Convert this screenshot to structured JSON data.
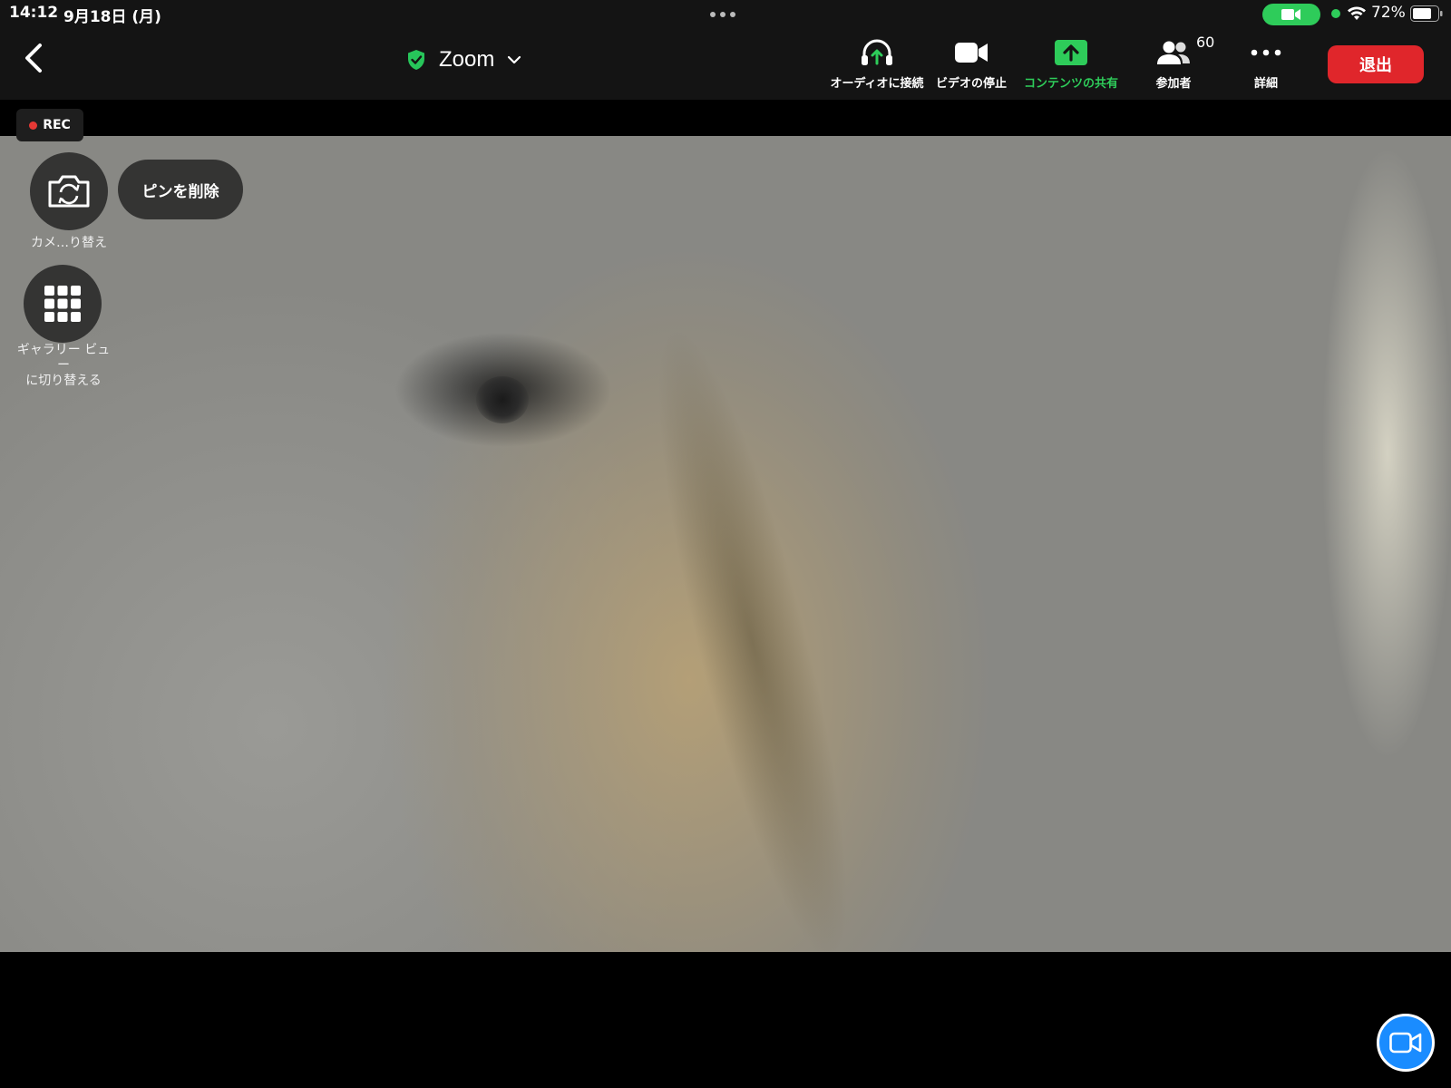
{
  "status_bar": {
    "time": "14:12",
    "date": "9月18日 (月)",
    "battery": "72%"
  },
  "toolbar": {
    "meeting_title": "Zoom",
    "audio_label": "オーディオに接続",
    "video_label": "ビデオの停止",
    "share_label": "コンテンツの共有",
    "participants_label": "参加者",
    "participants_count": "60",
    "more_label": "詳細",
    "leave_label": "退出"
  },
  "overlay": {
    "rec_label": "REC",
    "camera_switch_label": "カメ…り替え",
    "unpin_label": "ピンを削除",
    "gallery_label_line1": "ギャラリー ビュー",
    "gallery_label_line2": "に切り替える"
  },
  "colors": {
    "toolbar_bg": "#141414",
    "accent_green": "#2ecc5a",
    "leave_red": "#e0262b",
    "rec_red": "#e53935",
    "fab_blue": "#1a8cff",
    "secure_green": "#27c55a"
  },
  "icons": {
    "back": "chevron-left-icon",
    "secure": "shield-check-icon",
    "dropdown": "chevron-down-icon",
    "audio": "headphones-icon",
    "video": "video-camera-icon",
    "share": "share-arrow-up-icon",
    "participants": "people-icon",
    "more": "ellipsis-icon",
    "camera_switch": "camera-rotate-icon",
    "gallery": "grid-icon",
    "fab": "video-camera-icon"
  }
}
